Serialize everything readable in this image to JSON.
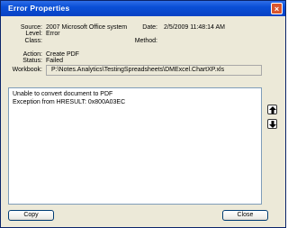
{
  "window": {
    "title": "Error Properties",
    "close_label": "×"
  },
  "fields": {
    "source_label": "Source:",
    "source_value": "2007 Microsoft Office system",
    "date_label": "Date:",
    "date_value": "2/5/2009 11:48:14 AM",
    "level_label": "Level:",
    "level_value": "Error",
    "class_label": "Class:",
    "class_value": "",
    "method_label": "Method:",
    "method_value": "",
    "action_label": "Action:",
    "action_value": "Create PDF",
    "status_label": "Status:",
    "status_value": "Failed",
    "workbook_label": "Workbook:",
    "workbook_value": "P:\\Notes.Analytics\\TestingSpreadsheets\\DMExcel.ChartXP.xls"
  },
  "message": {
    "line1": "Unable to convert document to PDF",
    "line2": "Exception from HRESULT: 0x800A03EC"
  },
  "buttons": {
    "copy": "Copy",
    "close": "Close"
  },
  "icons": {
    "up": "arrow-up-icon",
    "down": "arrow-down-icon"
  }
}
